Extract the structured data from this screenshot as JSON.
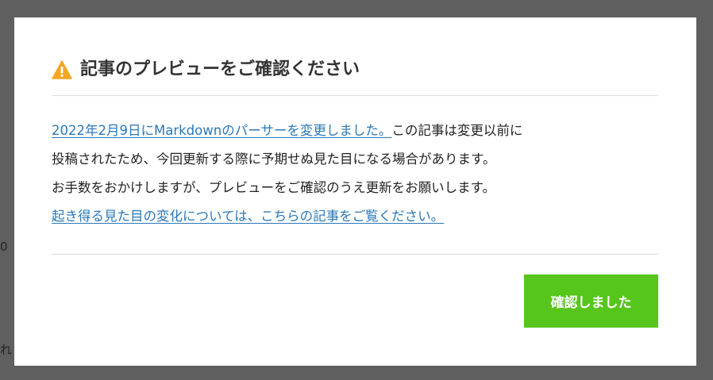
{
  "backdrop": {
    "fragment_top": "0",
    "fragment_bottom": "れ"
  },
  "dialog": {
    "title": "記事のプレビューをご確認ください",
    "warning_icon": "warning-triangle",
    "accent_color": "#f5a623",
    "paragraph1": {
      "link_text": "2022年2月9日にMarkdownのパーサーを変更しました。",
      "text": "この記事は変更以前に"
    },
    "paragraph2": "投稿されたため、今回更新する際に予期せぬ見た目になる場合があります。",
    "paragraph3": "お手数をおかけしますが、プレビューをご確認のうえ更新をお願いします。",
    "paragraph4_link": "起き得る見た目の変化については、こちらの記事をご覧ください。",
    "link_color": "#2a78b8",
    "confirm_label": "確認しました",
    "confirm_color": "#56c51c"
  }
}
